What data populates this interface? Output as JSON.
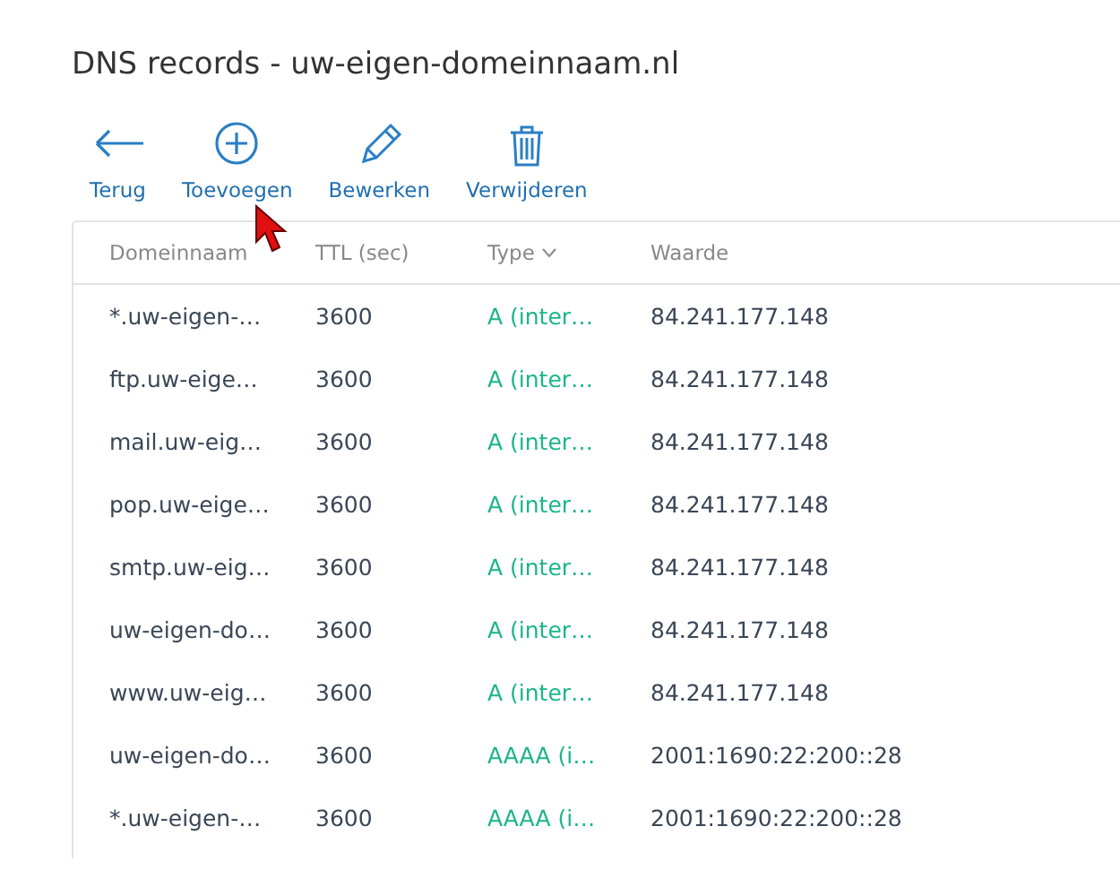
{
  "page": {
    "title": "DNS records - uw-eigen-domeinnaam.nl"
  },
  "toolbar": [
    {
      "kind": "back",
      "label": "Terug"
    },
    {
      "kind": "add",
      "label": "Toevoegen"
    },
    {
      "kind": "edit",
      "label": "Bewerken"
    },
    {
      "kind": "delete",
      "label": "Verwijderen"
    }
  ],
  "table": {
    "columns": [
      {
        "label": "Domeinnaam",
        "sorted": false
      },
      {
        "label": "TTL (sec)",
        "sorted": false
      },
      {
        "label": "Type",
        "sorted": true
      },
      {
        "label": "Waarde",
        "sorted": false
      }
    ],
    "rows": [
      [
        "*.uw-eigen-…",
        "3600",
        "A (inter…",
        "84.241.177.148"
      ],
      [
        "ftp.uw-eige…",
        "3600",
        "A (inter…",
        "84.241.177.148"
      ],
      [
        "mail.uw-eig…",
        "3600",
        "A (inter…",
        "84.241.177.148"
      ],
      [
        "pop.uw-eige…",
        "3600",
        "A (inter…",
        "84.241.177.148"
      ],
      [
        "smtp.uw-eig…",
        "3600",
        "A (inter…",
        "84.241.177.148"
      ],
      [
        "uw-eigen-do…",
        "3600",
        "A (inter…",
        "84.241.177.148"
      ],
      [
        "www.uw-eig…",
        "3600",
        "A (inter…",
        "84.241.177.148"
      ],
      [
        "uw-eigen-do…",
        "3600",
        "AAAA (i…",
        "2001:1690:22:200::28"
      ],
      [
        "*.uw-eigen-…",
        "3600",
        "AAAA (i…",
        "2001:1690:22:200::28"
      ]
    ]
  }
}
